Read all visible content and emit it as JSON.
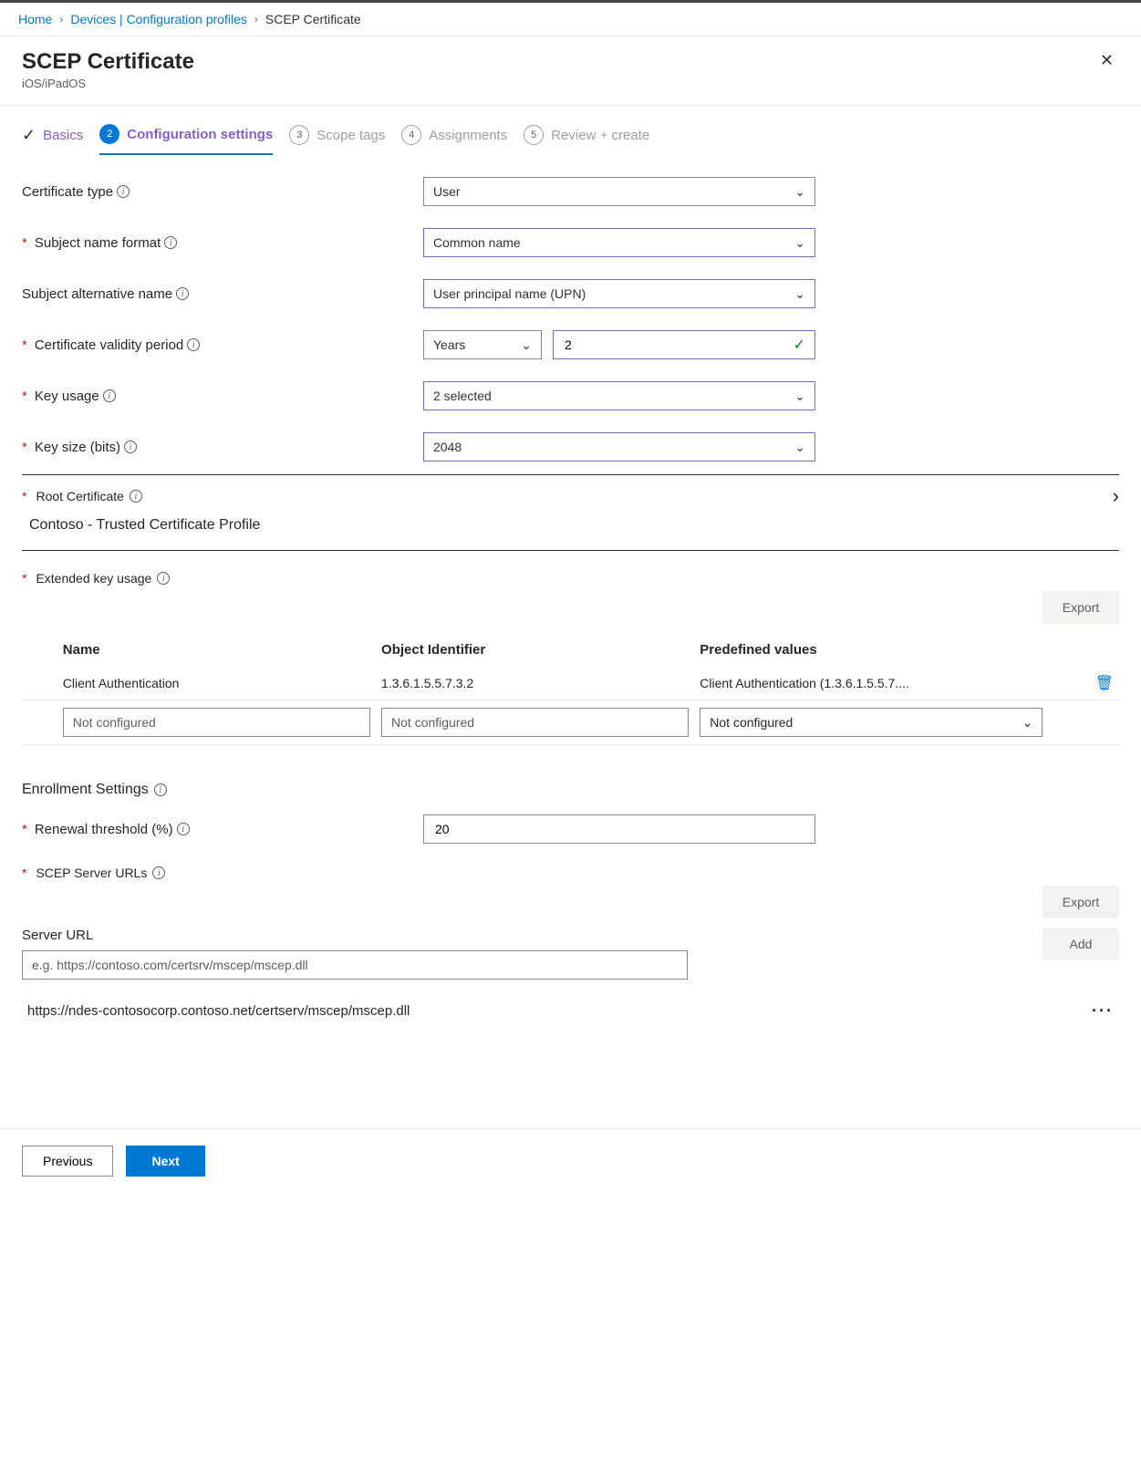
{
  "breadcrumb": {
    "items": [
      {
        "label": "Home"
      },
      {
        "label": "Devices | Configuration profiles"
      },
      {
        "label": "SCEP Certificate"
      }
    ]
  },
  "header": {
    "title": "SCEP Certificate",
    "subtitle": "iOS/iPadOS"
  },
  "wizard": {
    "steps": [
      {
        "label": "Basics"
      },
      {
        "label": "Configuration settings",
        "num": "2"
      },
      {
        "label": "Scope tags",
        "num": "3"
      },
      {
        "label": "Assignments",
        "num": "4"
      },
      {
        "label": "Review + create",
        "num": "5"
      }
    ]
  },
  "form": {
    "cert_type": {
      "label": "Certificate type",
      "value": "User"
    },
    "subject_name_format": {
      "label": "Subject name format",
      "value": "Common name"
    },
    "san": {
      "label": "Subject alternative name",
      "value": "User principal name (UPN)"
    },
    "validity": {
      "label": "Certificate validity period",
      "unit": "Years",
      "value": "2"
    },
    "key_usage": {
      "label": "Key usage",
      "value": "2 selected"
    },
    "key_size": {
      "label": "Key size (bits)",
      "value": "2048"
    },
    "root_cert": {
      "label": "Root Certificate",
      "value": "Contoso - Trusted Certificate Profile"
    },
    "eku": {
      "label": "Extended key usage",
      "export": "Export",
      "cols": {
        "name": "Name",
        "oid": "Object Identifier",
        "predef": "Predefined values"
      },
      "rows": [
        {
          "name": "Client Authentication",
          "oid": "1.3.6.1.5.5.7.3.2",
          "predef": "Client Authentication (1.3.6.1.5.5.7...."
        }
      ],
      "placeholder": "Not configured"
    },
    "enrollment": {
      "label": "Enrollment Settings",
      "renewal": {
        "label": "Renewal threshold (%)",
        "value": "20"
      },
      "scep_urls": {
        "label": "SCEP Server URLs",
        "export": "Export",
        "add": "Add",
        "input_label": "Server URL",
        "placeholder": "e.g. https://contoso.com/certsrv/mscep/mscep.dll",
        "items": [
          "https://ndes-contosocorp.contoso.net/certserv/mscep/mscep.dll"
        ]
      }
    }
  },
  "footer": {
    "previous": "Previous",
    "next": "Next"
  }
}
